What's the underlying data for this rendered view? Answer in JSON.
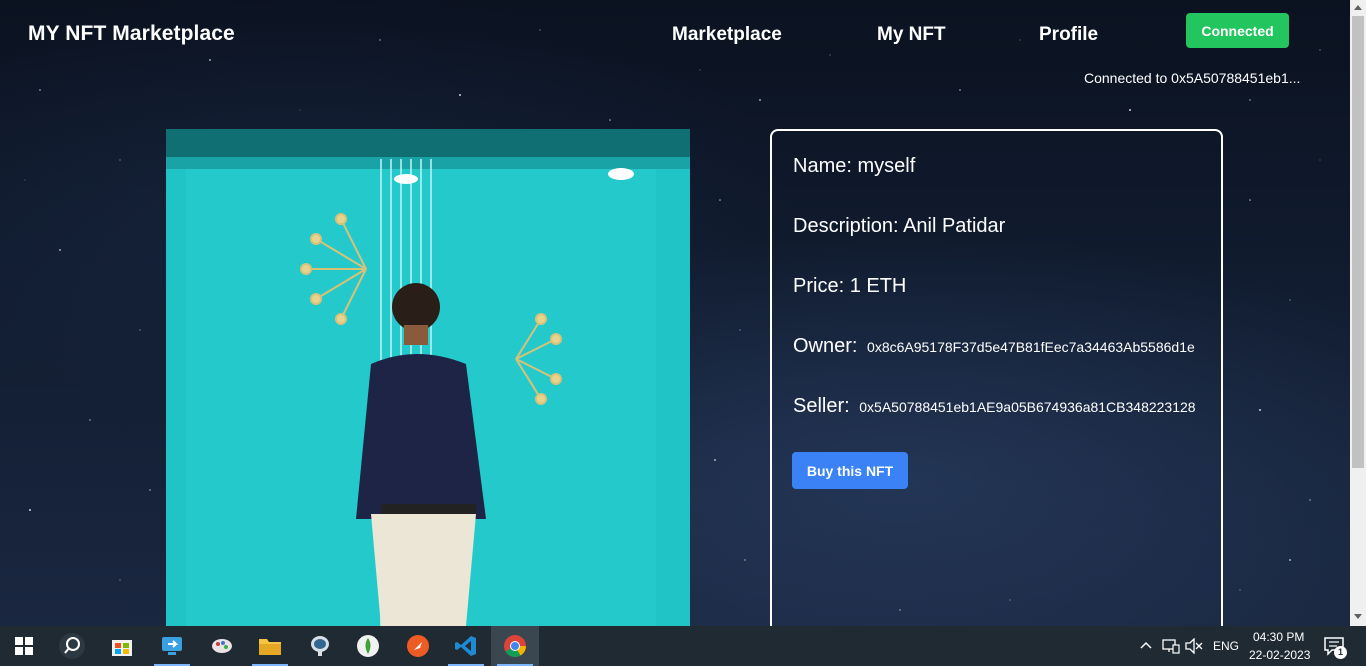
{
  "navbar": {
    "brand": "MY NFT Marketplace",
    "links": [
      "Marketplace",
      "My NFT",
      "Profile"
    ],
    "connect_button": "Connected",
    "connected_to": "Connected to 0x5A50788451eb1..."
  },
  "nft": {
    "name_label": "Name:",
    "name": "myself",
    "description_label": "Description:",
    "description": "Anil Patidar",
    "price_label": "Price:",
    "price": "1 ETH",
    "owner_label": "Owner:",
    "owner": "0x8c6A95178F37d5e47B81fEec7a34463Ab5586d1e",
    "seller_label": "Seller:",
    "seller": "0x5A50788451eb1AE9a05B674936a81CB348223128",
    "buy_button": "Buy this NFT"
  },
  "taskbar": {
    "apps": [
      "start-icon",
      "search-icon",
      "store-icon",
      "remote-desktop-icon",
      "paint-icon",
      "file-explorer-icon",
      "postgresql-icon",
      "mongodb-icon",
      "postman-icon",
      "vscode-icon",
      "chrome-icon"
    ],
    "language": "ENG",
    "time": "04:30 PM",
    "date": "22-02-2023",
    "notification_count": "1"
  },
  "colors": {
    "connect_green": "#22c55e",
    "buy_blue": "#3b82f6",
    "taskbar": "#1f2a33"
  }
}
